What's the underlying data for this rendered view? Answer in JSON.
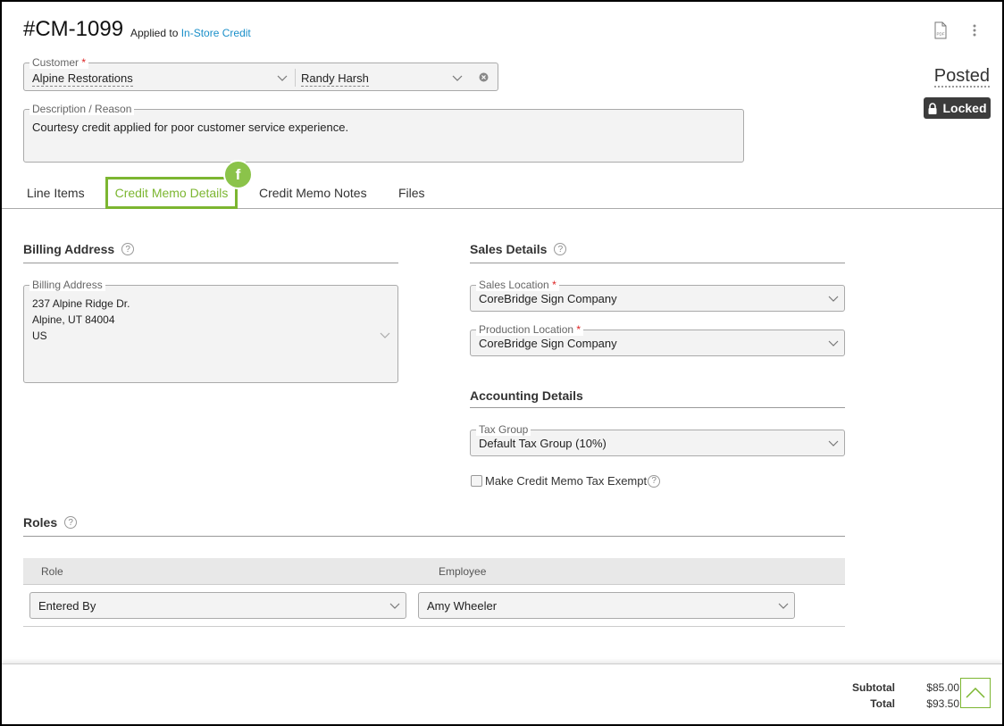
{
  "header": {
    "doc_number": "#CM-1099",
    "applied_prefix": "Applied to",
    "applied_link": "In-Store Credit",
    "status": "Posted",
    "locked_label": "Locked",
    "pdf_icon_text": "PDF"
  },
  "customer": {
    "label": "Customer",
    "required_mark": "*",
    "company": "Alpine Restorations",
    "contact": "Randy Harsh"
  },
  "description": {
    "label": "Description / Reason",
    "value": "Courtesy credit applied for poor customer service experience."
  },
  "tabs": [
    {
      "label": "Line Items"
    },
    {
      "label": "Credit Memo Details"
    },
    {
      "label": "Credit Memo Notes"
    },
    {
      "label": "Files"
    }
  ],
  "callout_badge": "f",
  "billing": {
    "title": "Billing Address",
    "field_label": "Billing Address",
    "line1": "237 Alpine Ridge Dr.",
    "line2": "Alpine, UT 84004",
    "line3": "US"
  },
  "sales": {
    "title": "Sales Details",
    "sales_location_label": "Sales Location",
    "sales_location_value": "CoreBridge Sign Company",
    "production_location_label": "Production Location",
    "production_location_value": "CoreBridge Sign Company"
  },
  "accounting": {
    "title": "Accounting Details",
    "tax_group_label": "Tax Group",
    "tax_group_value": "Default Tax Group  (10%)",
    "tax_exempt_label": "Make Credit Memo Tax Exempt"
  },
  "roles": {
    "title": "Roles",
    "col_role": "Role",
    "col_employee": "Employee",
    "rows": [
      {
        "role": "Entered By",
        "employee": "Amy Wheeler"
      }
    ]
  },
  "totals": {
    "subtotal_label": "Subtotal",
    "subtotal_value": "$85.00",
    "total_label": "Total",
    "total_value": "$93.50"
  },
  "help_glyph": "?",
  "colors": {
    "accent": "#7cb631",
    "link": "#1a8fc9",
    "locked_bg": "#3c3c3c"
  }
}
